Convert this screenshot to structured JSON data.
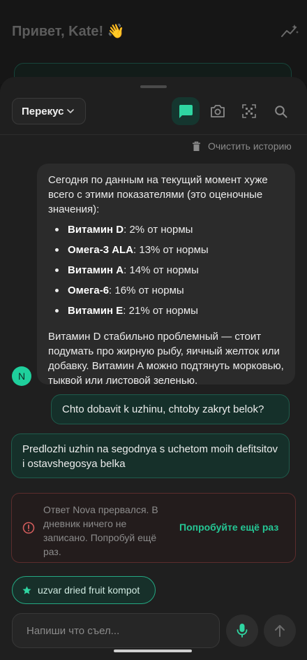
{
  "header": {
    "greeting": "Привет, Kate! 👋"
  },
  "toolbar": {
    "meal_type": "Перекус",
    "modes": [
      "chat-icon",
      "camera-icon",
      "qr-scan-icon",
      "search-icon"
    ],
    "active_mode": "chat"
  },
  "chat": {
    "clear_history_label": "Очистить историю",
    "bot_avatar_letter": "N",
    "bot_message": {
      "intro": "Сегодня по данным на текущий момент хуже всего с этими показателями (это оценочные значения):",
      "items": [
        {
          "name": "Витамин D",
          "value": ": 2% от нормы"
        },
        {
          "name": "Омега-3 ALA",
          "value": ": 13% от нормы"
        },
        {
          "name": "Витамин A",
          "value": ": 14% от нормы"
        },
        {
          "name": "Омега-6",
          "value": ": 16% от нормы"
        },
        {
          "name": "Витамин E",
          "value": ": 21% от нормы"
        }
      ],
      "footer": "Витамин D стабильно проблемный — стоит подумать про жирную рыбу, яичный желток или добавку. Витамин A можно подтянуть морковью, тыквой или листовой зеленью."
    },
    "user_message": "Chto dobavit k uzhinu, chtoby zakryt belok?",
    "pending_message": "Predlozhi uzhin na segodnya s uchetom moih defitsitov i ostavshegosya belka",
    "error": {
      "text": "Ответ Nova прервался. В дневник ничего не записано. Попробуй ещё раз.",
      "retry_label": "Попробуйте ещё раз"
    },
    "suggestion": "uzvar dried fruit kompot"
  },
  "composer": {
    "placeholder": "Напиши что съел..."
  },
  "colors": {
    "accent": "#24c795",
    "error_border": "#5c2c2c",
    "background": "#1f1f1f"
  }
}
